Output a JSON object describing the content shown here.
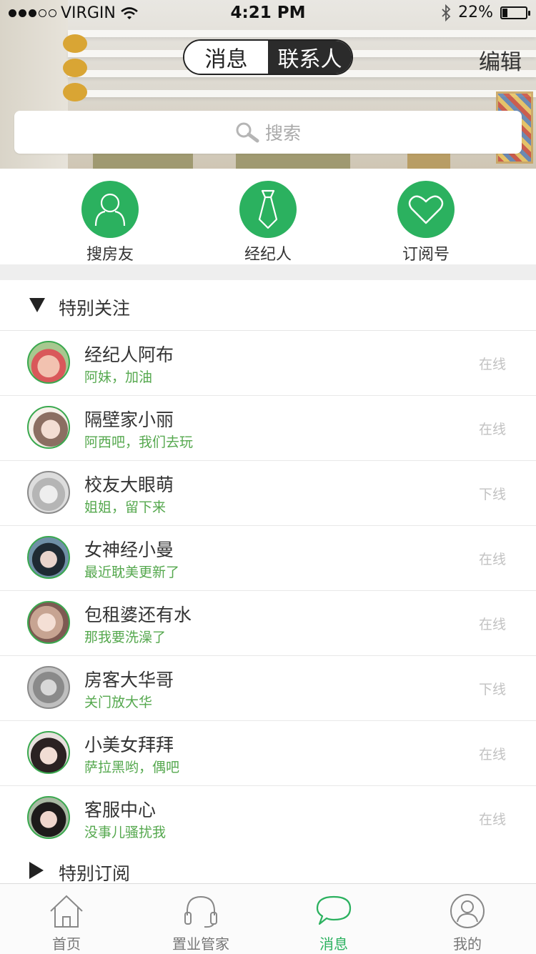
{
  "status_bar": {
    "carrier": "VIRGIN",
    "time": "4:21 PM",
    "battery": "22%",
    "battery_level": 0.22
  },
  "header": {
    "segments": [
      "消息",
      "联系人"
    ],
    "active_segment": "联系人",
    "edit_label": "编辑"
  },
  "search": {
    "placeholder": "搜索",
    "icon": "search-icon"
  },
  "quick_entries": [
    {
      "label": "搜房友",
      "icon": "person-icon"
    },
    {
      "label": "经纪人",
      "icon": "tie-icon"
    },
    {
      "label": "订阅号",
      "icon": "heart-icon"
    }
  ],
  "groups": {
    "special_follow": {
      "title": "特别关注",
      "expanded": true
    },
    "special_subscribe": {
      "title": "特别订阅",
      "expanded": false
    }
  },
  "contacts": [
    {
      "name": "经纪人阿布",
      "message": "阿妹，加油",
      "status": "在线"
    },
    {
      "name": "隔壁家小丽",
      "message": "阿西吧，我们去玩",
      "status": "在线"
    },
    {
      "name": "校友大眼萌",
      "message": "姐姐，留下来",
      "status": "下线"
    },
    {
      "name": "女神经小曼",
      "message": "最近耽美更新了",
      "status": "在线"
    },
    {
      "name": "包租婆还有水",
      "message": "那我要洗澡了",
      "status": "在线"
    },
    {
      "name": "房客大华哥",
      "message": "关门放大华",
      "status": "下线"
    },
    {
      "name": "小美女拜拜",
      "message": "萨拉黑哟，偶吧",
      "status": "在线"
    },
    {
      "name": "客服中心",
      "message": "没事儿骚扰我",
      "status": "在线"
    }
  ],
  "tabbar": {
    "items": [
      {
        "label": "首页",
        "icon": "home-icon"
      },
      {
        "label": "置业管家",
        "icon": "headset-icon"
      },
      {
        "label": "消息",
        "icon": "chat-bubble-icon"
      },
      {
        "label": "我的",
        "icon": "profile-icon"
      }
    ],
    "active": "消息"
  },
  "colors": {
    "accent_green": "#2bb15f",
    "message_green": "#55a84e",
    "status_gray": "#c2c2c2"
  }
}
